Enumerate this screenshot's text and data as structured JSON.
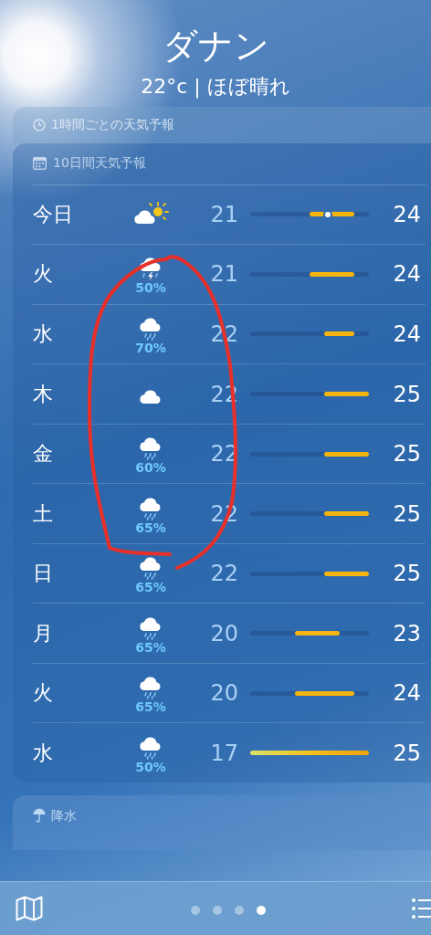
{
  "header": {
    "city": "ダナン",
    "current": "22°c | ほぼ晴れ"
  },
  "hourly_card": {
    "title": "1時間ごとの天気予報"
  },
  "ten_day": {
    "title": "10日間天気予報",
    "days": [
      {
        "day": "今日",
        "kind": "partly_sunny",
        "low": "21",
        "high": "24",
        "now": {
          "level": 0.65
        }
      },
      {
        "day": "火",
        "kind": "thunder_rain",
        "chance": "50%",
        "low": "21",
        "high": "24"
      },
      {
        "day": "水",
        "kind": "rain",
        "chance": "70%",
        "low": "22",
        "high": "24"
      },
      {
        "day": "木",
        "kind": "cloudy",
        "low": "22",
        "high": "25"
      },
      {
        "day": "金",
        "kind": "rain",
        "chance": "60%",
        "low": "22",
        "high": "25"
      },
      {
        "day": "土",
        "kind": "rain",
        "chance": "65%",
        "low": "22",
        "high": "25"
      },
      {
        "day": "日",
        "kind": "rain",
        "chance": "65%",
        "low": "22",
        "high": "25"
      },
      {
        "day": "月",
        "kind": "rain",
        "chance": "65%",
        "low": "20",
        "high": "23"
      },
      {
        "day": "火",
        "kind": "rain",
        "chance": "65%",
        "low": "20",
        "high": "24"
      },
      {
        "day": "水",
        "kind": "rain",
        "chance": "50%",
        "low": "17",
        "high": "25"
      }
    ]
  },
  "precipitation_card": {
    "title": "降水"
  },
  "pager": [
    {
      "selected": false
    },
    {
      "selected": false
    },
    {
      "selected": false
    },
    {
      "selected": true
    }
  ]
}
